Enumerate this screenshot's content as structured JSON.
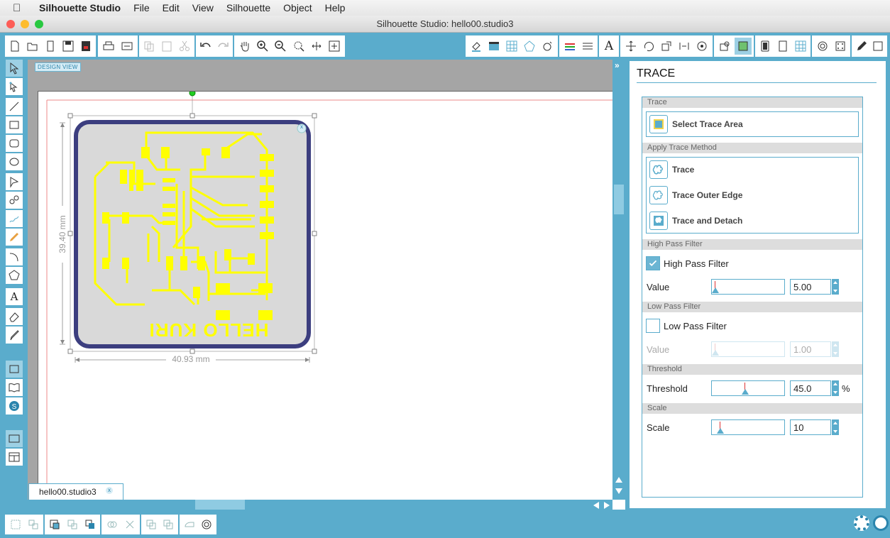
{
  "menubar": {
    "app": "Silhouette Studio",
    "items": [
      "File",
      "Edit",
      "View",
      "Silhouette",
      "Object",
      "Help"
    ]
  },
  "window": {
    "title": "Silhouette Studio: hello00.studio3"
  },
  "canvas": {
    "design_view_label": "DESIGN VIEW",
    "height_dim": "39.40 mm",
    "width_dim": "40.93 mm",
    "board_text": "HELLO KURI",
    "doc_tab": "hello00.studio3",
    "doc_tab_close": "x",
    "selection_close": "x"
  },
  "panel": {
    "title": "TRACE",
    "trace_section": "Trace",
    "select_area": "Select Trace Area",
    "method_section": "Apply Trace Method",
    "methods": [
      "Trace",
      "Trace Outer Edge",
      "Trace and Detach"
    ],
    "hpf_section": "High Pass Filter",
    "hpf_label": "High Pass Filter",
    "hpf_checked": true,
    "hpf_value_label": "Value",
    "hpf_value": "5.00",
    "lpf_section": "Low Pass Filter",
    "lpf_label": "Low Pass Filter",
    "lpf_checked": false,
    "lpf_value_label": "Value",
    "lpf_value": "1.00",
    "threshold_section": "Threshold",
    "threshold_label": "Threshold",
    "threshold_value": "45.0",
    "threshold_unit": "%",
    "scale_section": "Scale",
    "scale_label": "Scale",
    "scale_value": "10"
  },
  "colors": {
    "accent": "#5aaccc",
    "trace_yellow": "#ffff00",
    "board_border": "#3c3e7f",
    "board_fill": "#d9d9d9"
  }
}
